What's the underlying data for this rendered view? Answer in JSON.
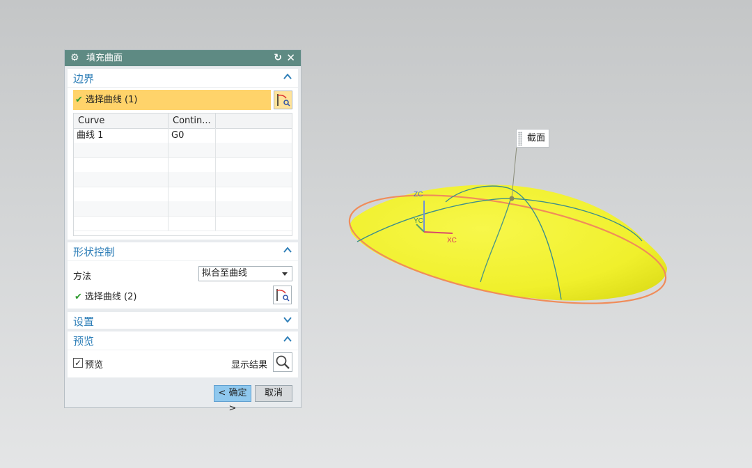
{
  "dialog": {
    "title": "填充曲面",
    "icons": {
      "settings": "gear-icon",
      "reset": "reset-icon",
      "close": "close-icon"
    }
  },
  "boundary": {
    "title": "边界",
    "select_label": "选择曲线 (1)",
    "table": {
      "headers": [
        "Curve",
        "Contin..."
      ],
      "rows": [
        [
          "曲线 1",
          "G0"
        ]
      ]
    }
  },
  "shape_control": {
    "title": "形状控制",
    "method_label": "方法",
    "method_value": "拟合至曲线",
    "select_label": "选择曲线 (2)"
  },
  "settings": {
    "title": "设置"
  },
  "preview": {
    "title": "预览",
    "checkbox_label": "预览",
    "checked": true,
    "show_result_label": "显示结果"
  },
  "buttons": {
    "ok": "< 确定 >",
    "cancel": "取消"
  },
  "viewport": {
    "section_tag": "截面",
    "axes": {
      "z": "ZC",
      "y": "YC",
      "x": "XC"
    },
    "colors": {
      "surface": "#f2f233",
      "boundary": "#f08c5a",
      "section_curves": "#3f8f8a"
    }
  }
}
